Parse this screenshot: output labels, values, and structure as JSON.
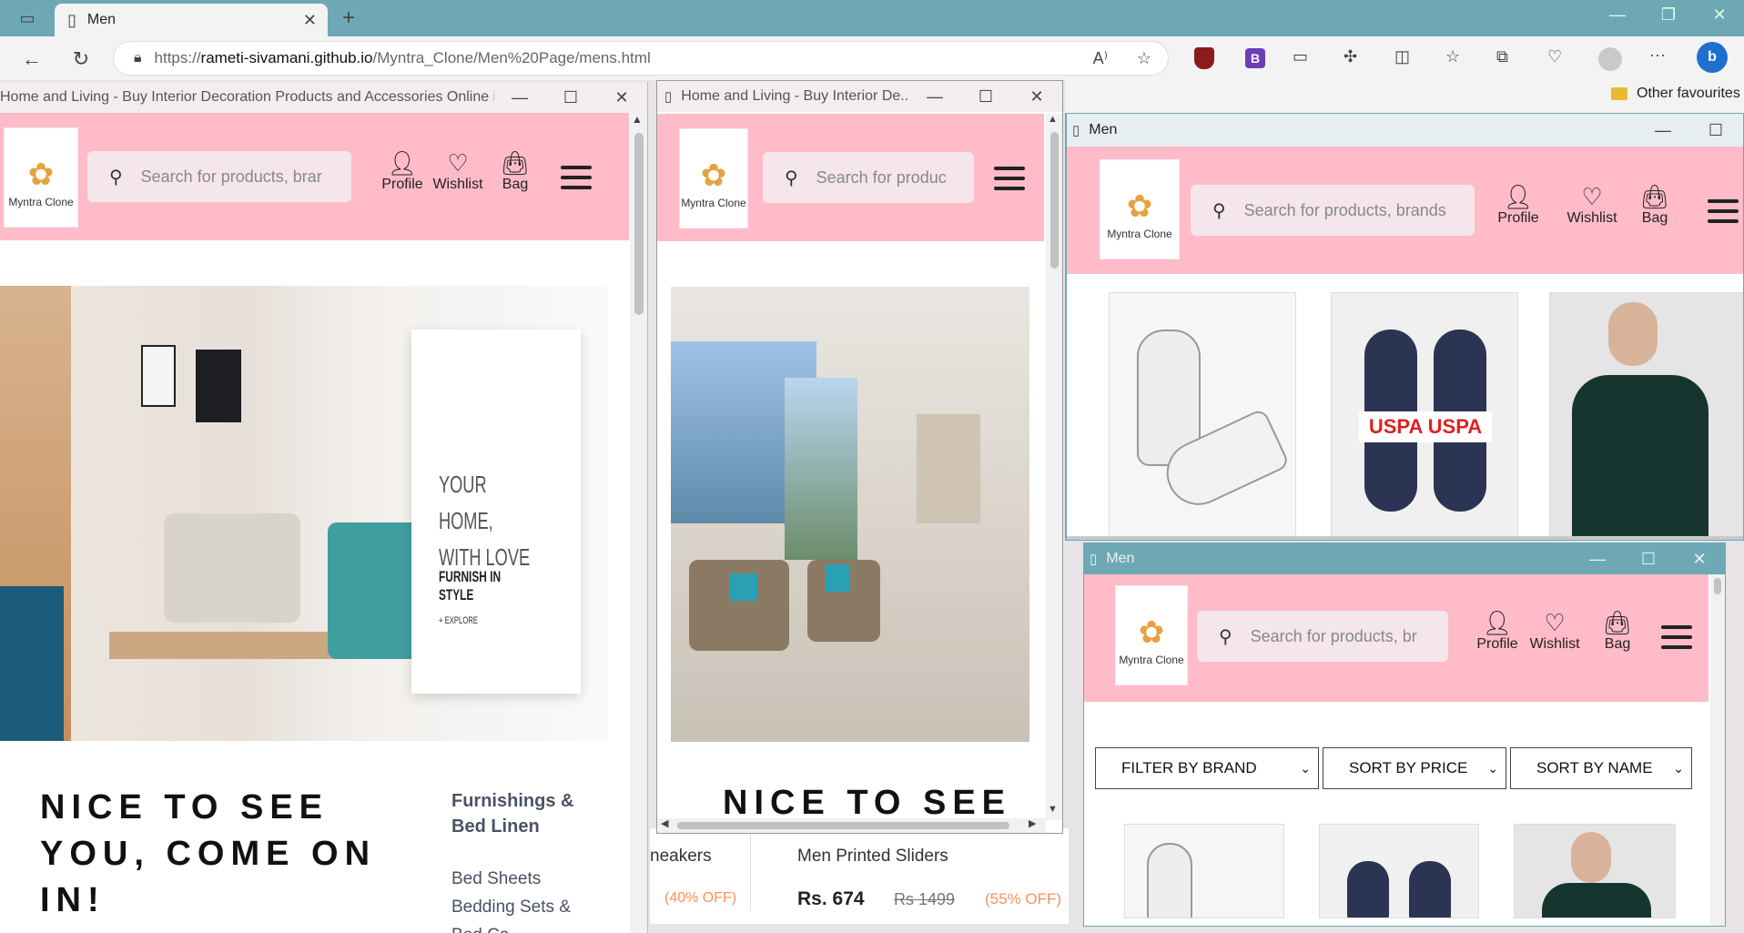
{
  "browser": {
    "tab_title": "Men",
    "url_prefix": "https://",
    "url_domain": "rameti-sivamani.github.io",
    "url_path": "/Myntra_Clone/Men%20Page/mens.html",
    "other_favourites": "Other favourites"
  },
  "site": {
    "logo_text": "Myntra Clone",
    "search_placeholder": "Search for products, brands",
    "profile": "Profile",
    "wishlist": "Wishlist",
    "bag": "Bag"
  },
  "win1": {
    "title": "Home and Living - Buy Interior Decoration Products and Accessories Online in I...",
    "search_text": "Search for products, brar",
    "banner_line1": "YOUR HOME,",
    "banner_line2": "WITH LOVE",
    "banner_line3": "FURNISH IN STYLE",
    "banner_line4": "+ EXPLORE",
    "heading": "NICE TO SEE YOU, COME ON IN!",
    "category_title": "Furnishings & Bed Linen",
    "category_items": [
      "Bed Sheets",
      "Bedding Sets &",
      "Bed Co..."
    ]
  },
  "win2": {
    "title": "Home and Living - Buy Interior De...",
    "search_text": "Search for produc",
    "heading": "NICE TO SEE"
  },
  "behind": {
    "sneakers": "neakers",
    "sneakers_discount": "(40% OFF)",
    "slider_name": "Men Printed Sliders",
    "slider_price": "Rs. 674",
    "slider_mrp": "Rs 1499",
    "slider_discount": "(55% OFF)"
  },
  "win3": {
    "title": "Men",
    "search_text": "Search for products, brands"
  },
  "win4": {
    "title": "Men",
    "search_text": "Search for products, br",
    "filters": [
      "FILTER BY BRAND",
      "SORT BY PRICE",
      "SORT BY NAME"
    ]
  },
  "colors": {
    "header_pink": "#ffbbc8",
    "titlebar_teal": "#6fa8b5"
  }
}
